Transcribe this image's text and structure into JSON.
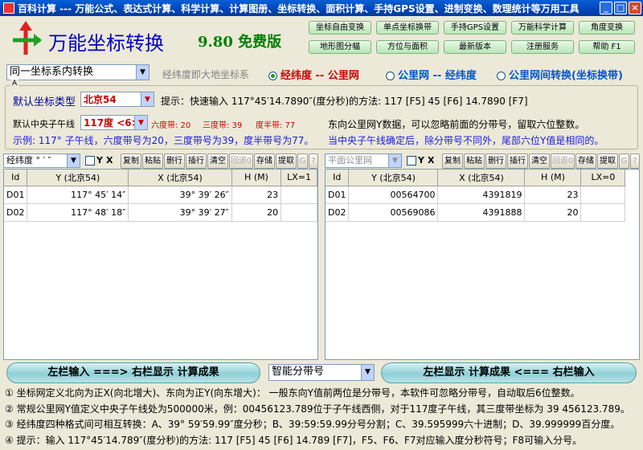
{
  "window": {
    "title": "百科计算 --- 万能公式、表达式计算、科学计算、计算图册、坐标转换、面积计算、手持GPS设置、进制变换、数理统计等万用工具",
    "min": "_",
    "max": "□",
    "close": "×"
  },
  "header": {
    "app_title": "万能坐标转换",
    "version": "9.80 免费版",
    "buttons": [
      "坐标自由变换",
      "单点坐标换带",
      "手持GPS设置",
      "万能科学计算",
      "角度变换",
      "地形图分幅",
      "方位与面积",
      "最新版本",
      "注册服务",
      "帮助 F1"
    ]
  },
  "mode": {
    "conversion_select": "同一坐标系内转换",
    "hint": "经纬度即大地坐标系",
    "radios": [
      {
        "label": "经纬度 -- 公里网",
        "selected": true
      },
      {
        "label": "公里网 -- 经纬度",
        "selected": false
      },
      {
        "label": "公里网间转换(坐标换带)",
        "selected": false
      }
    ]
  },
  "settings": {
    "legend": "A",
    "coord_type_label": "默认坐标类型",
    "coord_type_value": "北京54",
    "tip": "提示：快速输入 117°45′14.7890″(度分秒)的方法:  117 [F5]   45 [F6]   14.7890 [F7]",
    "meridian_label": "默认中央子午线",
    "meridian_value": "117度 <6>",
    "band6": "六度带: 20",
    "band3": "三度带: 39",
    "bandhalf": "度半带: 77",
    "note1": "东向公里网Y数据，可以忽略前面的分带号，留取六位整数。",
    "example": "示例: 117° 子午线，六度带号为20，三度带号为39，度半带号为77。",
    "note2": "当中央子午线确定后，除分带号不同外，尾部六位Y值是相同的。"
  },
  "left_toolbar": {
    "format_select": "经纬度 ° ′ ″",
    "y": "Y",
    "x": "X",
    "buttons": [
      "复制",
      "粘贴",
      "删行",
      "插行",
      "清空",
      "回退0",
      "存储",
      "提取",
      "G",
      "?"
    ],
    "disabled": [
      false,
      false,
      false,
      false,
      false,
      true,
      false,
      false,
      true,
      true
    ]
  },
  "right_toolbar": {
    "format_select": "平面公里网",
    "y": "Y",
    "x": "X",
    "buttons": [
      "复制",
      "粘贴",
      "删行",
      "插行",
      "清空",
      "回退0",
      "存储",
      "提取",
      "G",
      "?"
    ],
    "disabled": [
      false,
      false,
      false,
      false,
      false,
      true,
      false,
      false,
      true,
      true
    ]
  },
  "left_grid": {
    "headers": [
      "Id",
      "Y (北京54)",
      "X (北京54)",
      "H (M)",
      "LX=1"
    ],
    "rows": [
      [
        "D01",
        "117° 45′ 14″",
        "39° 39′ 26″",
        "23",
        ""
      ],
      [
        "D02",
        "117° 48′ 18″",
        "39° 39′ 27″",
        "20",
        ""
      ]
    ]
  },
  "right_grid": {
    "headers": [
      "Id",
      "Y (北京54)",
      "X (北京54)",
      "H (M)",
      "LX=0"
    ],
    "rows": [
      [
        "D01",
        "00564700",
        "4391819",
        "23",
        ""
      ],
      [
        "D02",
        "00569086",
        "4391888",
        "20",
        ""
      ]
    ]
  },
  "actions": {
    "left_to_right": "左栏输入 ===> 右栏显示  计算成果",
    "zone_select": "智能分带号",
    "right_to_left": "左栏显示  计算成果 <=== 右栏输入"
  },
  "notes": [
    "① 坐标网定义北向为正X(向北增大)、东向为正Y(向东增大)：  一般东向Y值前两位是分带号，本软件可忽略分带号，自动取后6位整数。",
    "② 常规公里网Y值定义中央子午线处为500000米，例：00456123.789位于子午线西侧，对于117度子午线，其三度带坐标为 39 456123.789。",
    "③ 经纬度四种格式间可相互转换：A、39° 59′59.99″度分秒；B、39:59:59.99分号分割；C、39.595999六十进制；D、39.999999百分度。",
    "④ 提示：输入 117°45′14.789″(度分秒)的方法:  117 [F5]   45 [F6]   14.789 [F7]，F5、F6、F7对应输入度分秒符号；F8可输入分号。"
  ],
  "colors": {
    "title_blue": "#0000c8",
    "version_green": "#008000",
    "accent_red": "#cc0000",
    "example_blue": "#1a1ae0"
  }
}
